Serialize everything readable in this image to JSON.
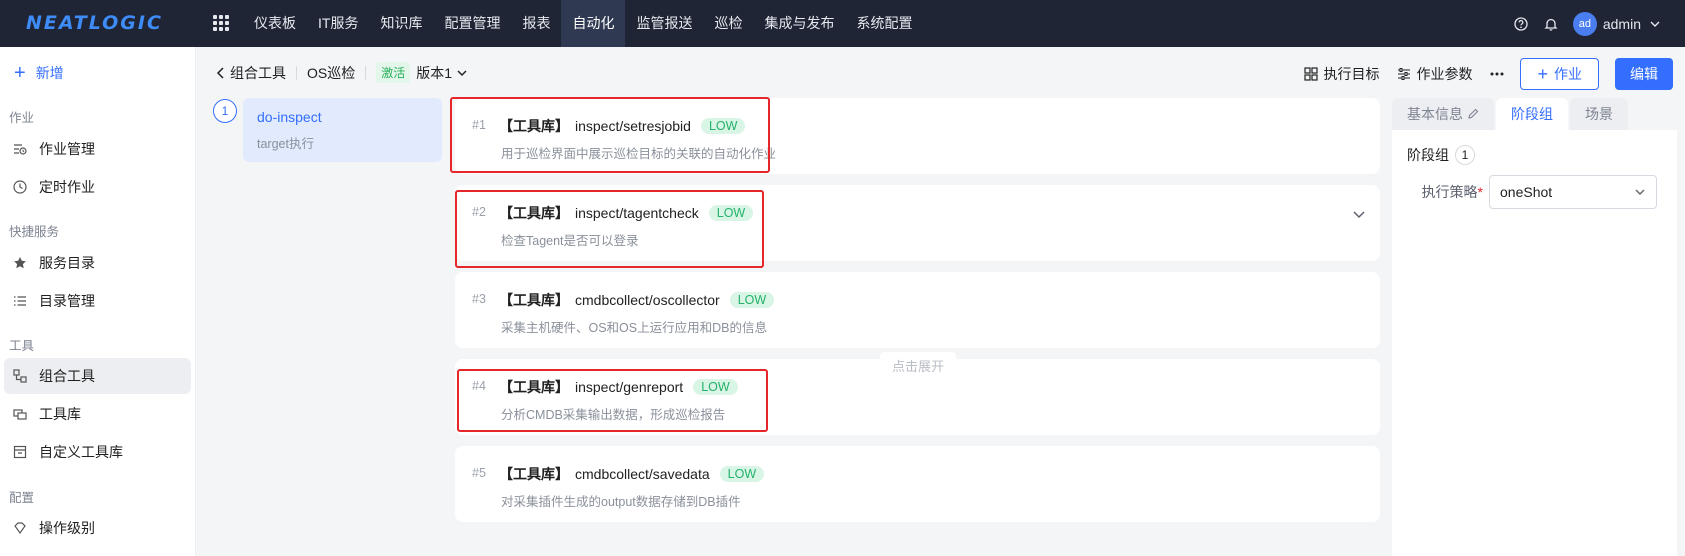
{
  "brand": {
    "logo_text": "NEATLOGIC"
  },
  "topnav": {
    "items": [
      {
        "label": "仪表板"
      },
      {
        "label": "IT服务"
      },
      {
        "label": "知识库"
      },
      {
        "label": "配置管理"
      },
      {
        "label": "报表"
      },
      {
        "label": "自动化",
        "active": true
      },
      {
        "label": "监管报送"
      },
      {
        "label": "巡检"
      },
      {
        "label": "集成与发布"
      },
      {
        "label": "系统配置"
      }
    ],
    "user": {
      "avatar": "ad",
      "name": "admin"
    },
    "icons": [
      "apps-grid-icon",
      "help-icon",
      "bell-icon",
      "chevron-down-icon"
    ]
  },
  "sidebar": {
    "new_label": "新增",
    "groups": [
      {
        "title": "作业",
        "items": [
          {
            "label": "作业管理",
            "icon": "job-list-icon"
          },
          {
            "label": "定时作业",
            "icon": "clock-icon"
          }
        ]
      },
      {
        "title": "快捷服务",
        "items": [
          {
            "label": "服务目录",
            "icon": "star-icon"
          },
          {
            "label": "目录管理",
            "icon": "list-icon"
          }
        ]
      },
      {
        "title": "工具",
        "items": [
          {
            "label": "组合工具",
            "icon": "combo-tool-icon",
            "active": true
          },
          {
            "label": "工具库",
            "icon": "tool-library-icon"
          },
          {
            "label": "自定义工具库",
            "icon": "custom-tool-icon"
          }
        ]
      },
      {
        "title": "配置",
        "items": [
          {
            "label": "操作级别",
            "icon": "level-icon"
          }
        ]
      }
    ]
  },
  "header": {
    "back_label": "组合工具",
    "name": "OS巡检",
    "status": "激活",
    "version": "版本1",
    "actions": {
      "target": "执行目标",
      "params": "作业参数",
      "add_job": "作业",
      "edit": "编辑"
    }
  },
  "stage": {
    "index": "1",
    "name": "do-inspect",
    "desc": "target执行"
  },
  "steps": [
    {
      "no": "#1",
      "lib": "【工具库】",
      "name": "inspect/setresjobid",
      "level": "LOW",
      "desc": "用于巡检界面中展示巡检目标的关联的自动化作业"
    },
    {
      "no": "#2",
      "lib": "【工具库】",
      "name": "inspect/tagentcheck",
      "level": "LOW",
      "desc": "检查Tagent是否可以登录"
    },
    {
      "no": "#3",
      "lib": "【工具库】",
      "name": "cmdbcollect/oscollector",
      "level": "LOW",
      "desc": "采集主机硬件、OS和OS上运行应用和DB的信息"
    },
    {
      "no": "#4",
      "lib": "【工具库】",
      "name": "inspect/genreport",
      "level": "LOW",
      "desc": "分析CMDB采集输出数据，形成巡检报告"
    },
    {
      "no": "#5",
      "lib": "【工具库】",
      "name": "cmdbcollect/savedata",
      "level": "LOW",
      "desc": "对采集插件生成的output数据存储到DB插件"
    }
  ],
  "expand_hint": "点击展开",
  "panel": {
    "tabs": [
      {
        "label": "基本信息"
      },
      {
        "label": "阶段组",
        "active": true
      },
      {
        "label": "场景"
      }
    ],
    "group_label": "阶段组",
    "group_count": "1",
    "strategy_label": "执行策略",
    "strategy_value": "oneShot"
  },
  "colors": {
    "primary": "#336eff",
    "topbar": "#1f2535",
    "low_badge": "#25b26a",
    "highlight_box": "#e5262a"
  }
}
